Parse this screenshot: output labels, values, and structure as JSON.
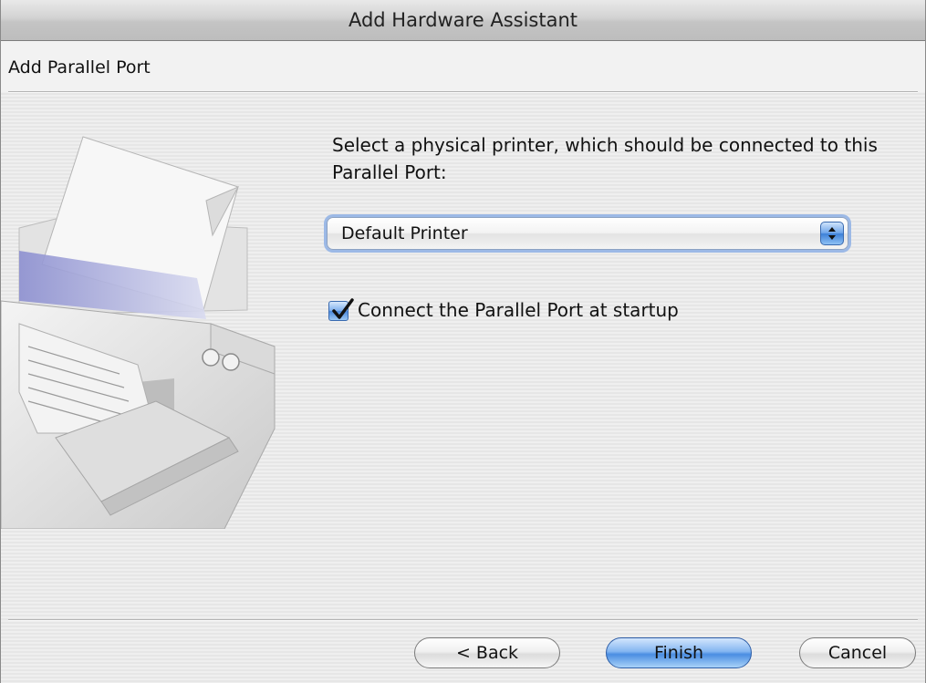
{
  "window": {
    "title": "Add Hardware Assistant"
  },
  "header": {
    "title": "Add Parallel Port"
  },
  "main": {
    "instruction": "Select a physical printer, which should be connected to this Parallel Port:",
    "printer_select": {
      "selected": "Default Printer"
    },
    "connect_checkbox": {
      "label": "Connect the Parallel Port at startup",
      "checked": true
    }
  },
  "footer": {
    "back_label": "< Back",
    "finish_label": "Finish",
    "cancel_label": "Cancel"
  },
  "colors": {
    "accent": "#4a8de2",
    "background": "#ececec"
  },
  "icons": {
    "illustration": "printer-illustration",
    "popup": "chevron-up-down-icon",
    "check": "checkmark-icon"
  }
}
